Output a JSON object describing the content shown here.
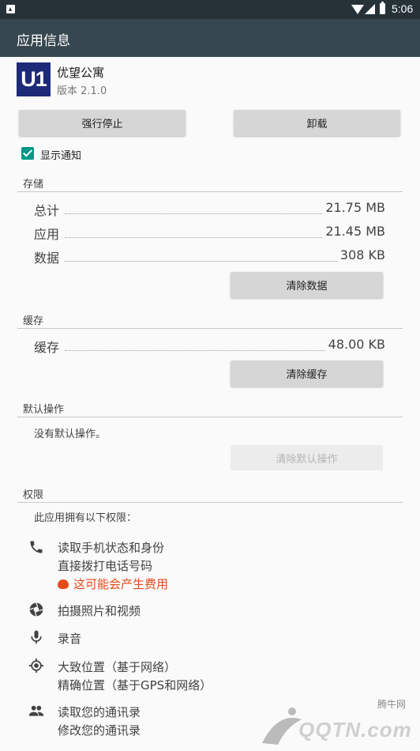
{
  "status_bar": {
    "time": "5:06"
  },
  "app_bar": {
    "title": "应用信息"
  },
  "app": {
    "icon_text": "U1",
    "name": "优望公寓",
    "version": "版本 2.1.0"
  },
  "buttons": {
    "force_stop": "强行停止",
    "uninstall": "卸载"
  },
  "notifications": {
    "label": "显示通知",
    "checked": true
  },
  "storage": {
    "header": "存储",
    "rows": [
      {
        "label": "总计",
        "value": "21.75 MB"
      },
      {
        "label": "应用",
        "value": "21.45 MB"
      },
      {
        "label": "数据",
        "value": "308 KB"
      }
    ],
    "clear_button": "清除数据"
  },
  "cache": {
    "header": "缓存",
    "row": {
      "label": "缓存",
      "value": "48.00 KB"
    },
    "clear_button": "清除缓存"
  },
  "defaults": {
    "header": "默认操作",
    "text": "没有默认操作。",
    "clear_button": "清除默认操作"
  },
  "permissions": {
    "header": "权限",
    "intro": "此应用拥有以下权限：",
    "groups": [
      {
        "icon": "phone-icon",
        "items": [
          "读取手机状态和身份",
          "直接拨打电话号码"
        ],
        "warning": "这可能会产生费用"
      },
      {
        "icon": "camera-icon",
        "items": [
          "拍摄照片和视频"
        ]
      },
      {
        "icon": "microphone-icon",
        "items": [
          "录音"
        ]
      },
      {
        "icon": "location-icon",
        "items": [
          "大致位置（基于网络）",
          "精确位置（基于GPS和网络）"
        ]
      },
      {
        "icon": "contacts-icon",
        "items": [
          "读取您的通讯录",
          "修改您的通讯录"
        ]
      }
    ]
  },
  "watermark": {
    "site": "腾牛网",
    "logo": "QQTN.com"
  },
  "colors": {
    "status_bar": "#263238",
    "app_bar": "#37474f",
    "accent": "#009688",
    "warning": "#e64a19",
    "app_icon": "#1e2a78"
  }
}
